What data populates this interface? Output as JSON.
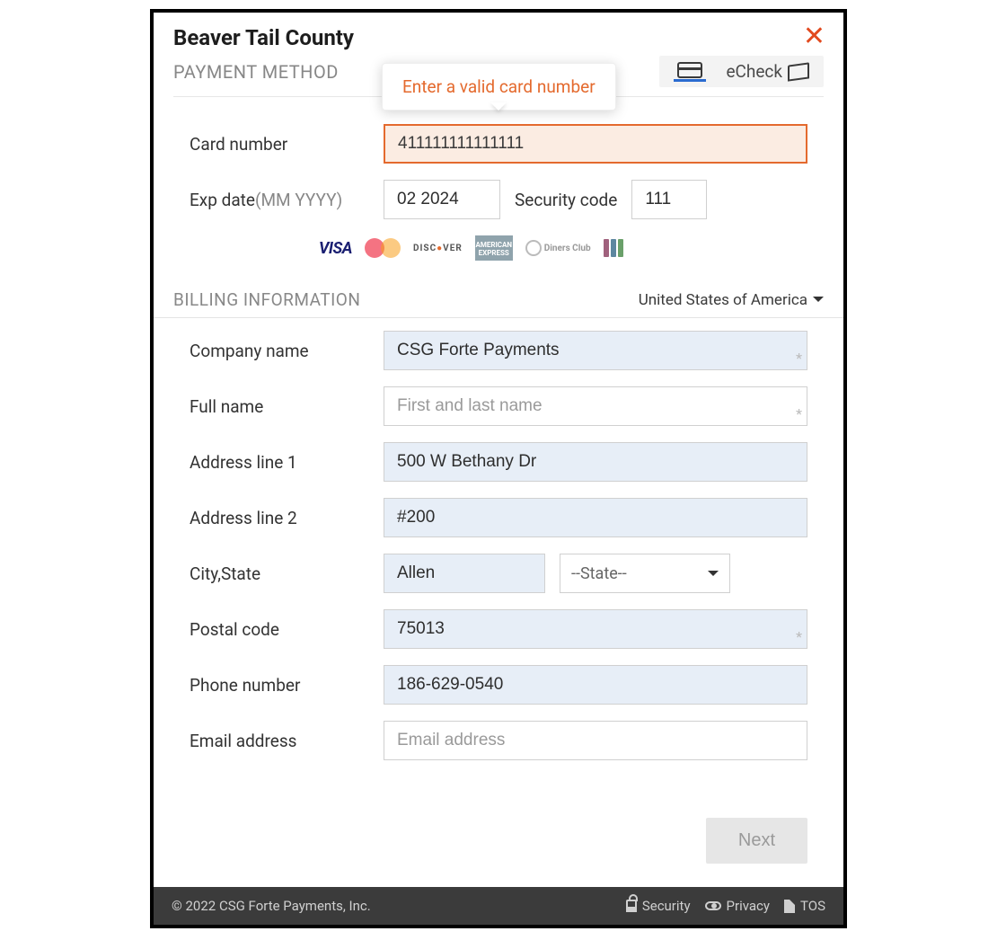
{
  "header": {
    "title": "Beaver Tail County",
    "subhead": "PAYMENT METHOD",
    "tabs": {
      "echeck": "eCheck"
    },
    "tooltip": "Enter a valid card number"
  },
  "payment": {
    "card_number_label": "Card number",
    "card_number_value": "411111111111111",
    "exp_label": "Exp date",
    "exp_hint": "(MM YYYY)",
    "exp_value": "02 2024",
    "security_label": "Security code",
    "security_value": "111",
    "card_brands": [
      "VISA",
      "mastercard",
      "DISCOVER",
      "AMERICAN EXPRESS",
      "Diners Club",
      "JCB"
    ]
  },
  "billing": {
    "section_title": "BILLING INFORMATION",
    "country_selected": "United States of America",
    "company_label": "Company name",
    "company_value": "CSG Forte Payments",
    "fullname_label": "Full name",
    "fullname_placeholder": "First and last name",
    "addr1_label": "Address line 1",
    "addr1_value": "500 W Bethany Dr",
    "addr2_label": "Address line 2",
    "addr2_value": "#200",
    "citystate_label": "City,State",
    "city_value": "Allen",
    "state_placeholder": "--State--",
    "postal_label": "Postal code",
    "postal_value": "75013",
    "phone_label": "Phone number",
    "phone_value": "186-629-0540",
    "email_label": "Email address",
    "email_placeholder": "Email address"
  },
  "actions": {
    "next": "Next"
  },
  "footer": {
    "copyright": "© 2022 CSG Forte Payments, Inc.",
    "security": "Security",
    "privacy": "Privacy",
    "tos": "TOS"
  }
}
